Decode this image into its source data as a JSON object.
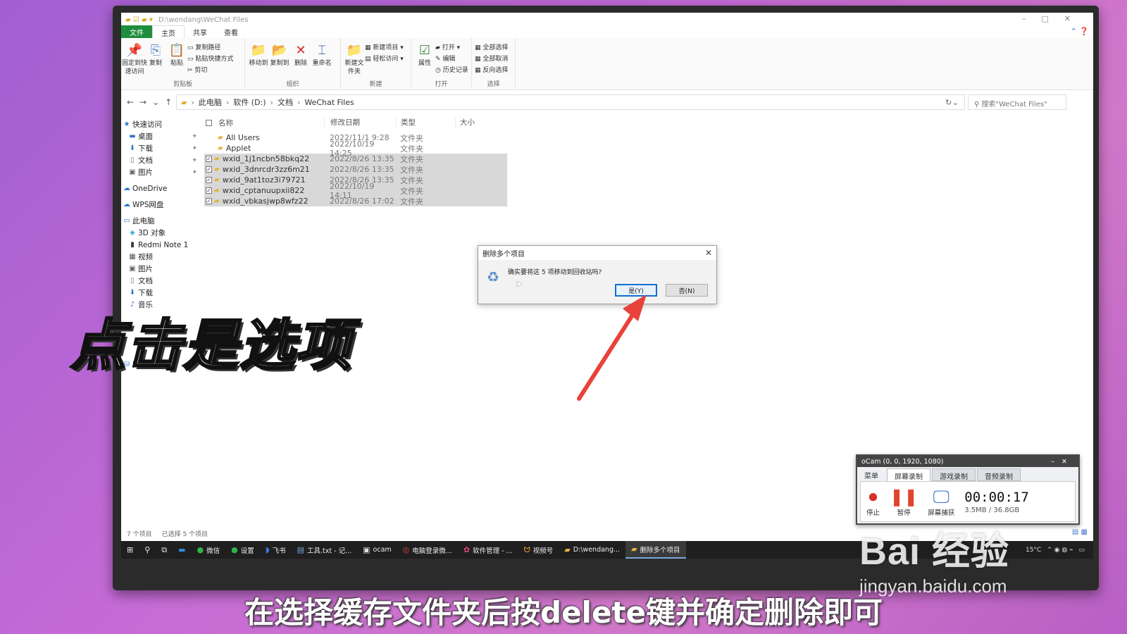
{
  "window": {
    "path_title": "D:\\wendang\\WeChat Files"
  },
  "ribbon_tabs": [
    "文件",
    "主页",
    "共享",
    "查看"
  ],
  "ribbon": {
    "clipboard": {
      "group": "剪贴板",
      "pin": "固定到快速访问",
      "copy": "复制",
      "paste": "粘贴",
      "copy_path": "复制路径",
      "paste_shortcut": "粘贴快捷方式",
      "cut": "剪切"
    },
    "organize": {
      "group": "组织",
      "move_to": "移动到",
      "copy_to": "复制到",
      "delete": "删除",
      "rename": "重命名"
    },
    "new": {
      "group": "新建",
      "new_folder": "新建文件夹",
      "new_item": "新建项目",
      "easy_access": "轻松访问"
    },
    "open": {
      "group": "打开",
      "properties": "属性",
      "open": "打开",
      "edit": "编辑",
      "history": "历史记录"
    },
    "select": {
      "group": "选择",
      "select_all": "全部选择",
      "select_none": "全部取消",
      "invert": "反向选择"
    }
  },
  "address": {
    "segments": [
      "此电脑",
      "软件 (D:)",
      "文档",
      "WeChat Files"
    ],
    "search_placeholder": "搜索\"WeChat Files\""
  },
  "nav": {
    "quick_access": "快速访问",
    "quick_items": [
      "桌面",
      "下载",
      "文档",
      "图片"
    ],
    "onedrive": "OneDrive",
    "wps": "WPS网盘",
    "this_pc": "此电脑",
    "pc_items": [
      "3D 对象",
      "Redmi Note 1",
      "视频",
      "图片",
      "文档",
      "下载",
      "音乐"
    ],
    "network": "网络"
  },
  "columns": {
    "name": "名称",
    "date": "修改日期",
    "type": "类型",
    "size": "大小"
  },
  "files": [
    {
      "name": "All Users",
      "date": "2022/11/1 9:28",
      "type": "文件夹",
      "selected": false
    },
    {
      "name": "Applet",
      "date": "2022/10/19 14:25",
      "type": "文件夹",
      "selected": false
    },
    {
      "name": "wxid_1j1ncbn58bkq22",
      "date": "2022/8/26 13:35",
      "type": "文件夹",
      "selected": true
    },
    {
      "name": "wxid_3dnrcdr3zz6m21",
      "date": "2022/8/26 13:35",
      "type": "文件夹",
      "selected": true
    },
    {
      "name": "wxid_9at1toz3i79721",
      "date": "2022/8/26 13:35",
      "type": "文件夹",
      "selected": true
    },
    {
      "name": "wxid_cptanuupxii822",
      "date": "2022/10/19 14:11",
      "type": "文件夹",
      "selected": true
    },
    {
      "name": "wxid_vbkasjwp8wfz22",
      "date": "2022/8/26 17:02",
      "type": "文件夹",
      "selected": true
    }
  ],
  "status": {
    "count": "7 个项目",
    "selected": "已选择 5 个项目"
  },
  "dialog": {
    "title": "删除多个项目",
    "message": "确实要将这 5 项移动到回收站吗?",
    "yes": "是(Y)",
    "no": "否(N)"
  },
  "taskbar": {
    "items": [
      {
        "label": "微信",
        "icon": "wechat-icon"
      },
      {
        "label": "设置",
        "icon": "wechat-icon"
      },
      {
        "label": "飞书",
        "icon": "feishu-icon"
      },
      {
        "label": "工具.txt - 记...",
        "icon": "notepad-icon"
      },
      {
        "label": "ocam",
        "icon": "ocam-icon"
      },
      {
        "label": "电脑登录微...",
        "icon": "chrome-icon"
      },
      {
        "label": "软件管理 - ...",
        "icon": "app-icon"
      },
      {
        "label": "视频号",
        "icon": "video-icon"
      },
      {
        "label": "D:\\wendang...",
        "icon": "folder-icon"
      },
      {
        "label": "删除多个项目",
        "icon": "folder-icon"
      }
    ],
    "temp": "15°C"
  },
  "ocam": {
    "title": "oCam (0, 0, 1920, 1080)",
    "tabs": [
      "菜单",
      "屏幕录制",
      "游戏录制",
      "音频录制"
    ],
    "stop": "停止",
    "pause": "暂停",
    "screen": "屏幕捕获",
    "time": "00:00:17",
    "size": "3.5MB / 36.8GB"
  },
  "overlay": {
    "caption": "点击是选项",
    "subtitle": "在选择缓存文件夹后按delete键并确定删除即可"
  },
  "watermark": {
    "brand": "Bai 经验",
    "url": "jingyan.baidu.com"
  },
  "colors": {
    "accent": "#1e8e3e",
    "selection": "#d8d8d8",
    "arrow": "#e8423a",
    "dialog_default_border": "#0f6fd1"
  }
}
